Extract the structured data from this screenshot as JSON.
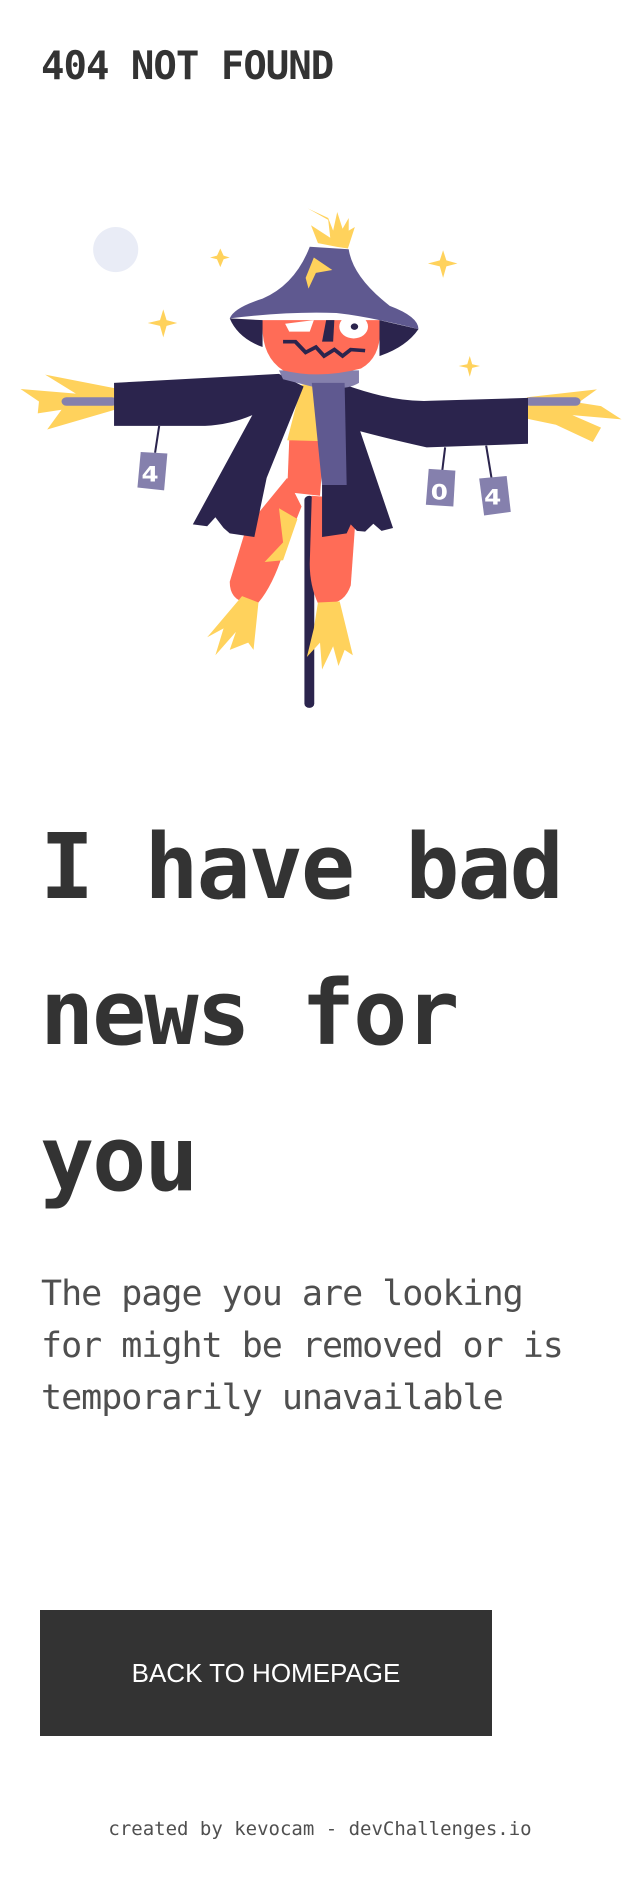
{
  "header": {
    "title": "404 NOT FOUND"
  },
  "illustration": {
    "icon": "scarecrow-illustration",
    "cans": [
      "4",
      "0",
      "4"
    ],
    "colors": {
      "coat": "#2b244d",
      "hat": "#5f5990",
      "skin": "#ff6c57",
      "straw": "#ffd25c",
      "can": "#8580ad",
      "moon": "#e9ecf6"
    }
  },
  "main": {
    "headline": "I have bad news for you",
    "description": "The page you are looking for might be removed or is temporarily unavailable",
    "button_label": "BACK TO HOMEPAGE",
    "button_color": "#333333"
  },
  "footer": {
    "text": "created by kevocam - devChallenges.io"
  }
}
